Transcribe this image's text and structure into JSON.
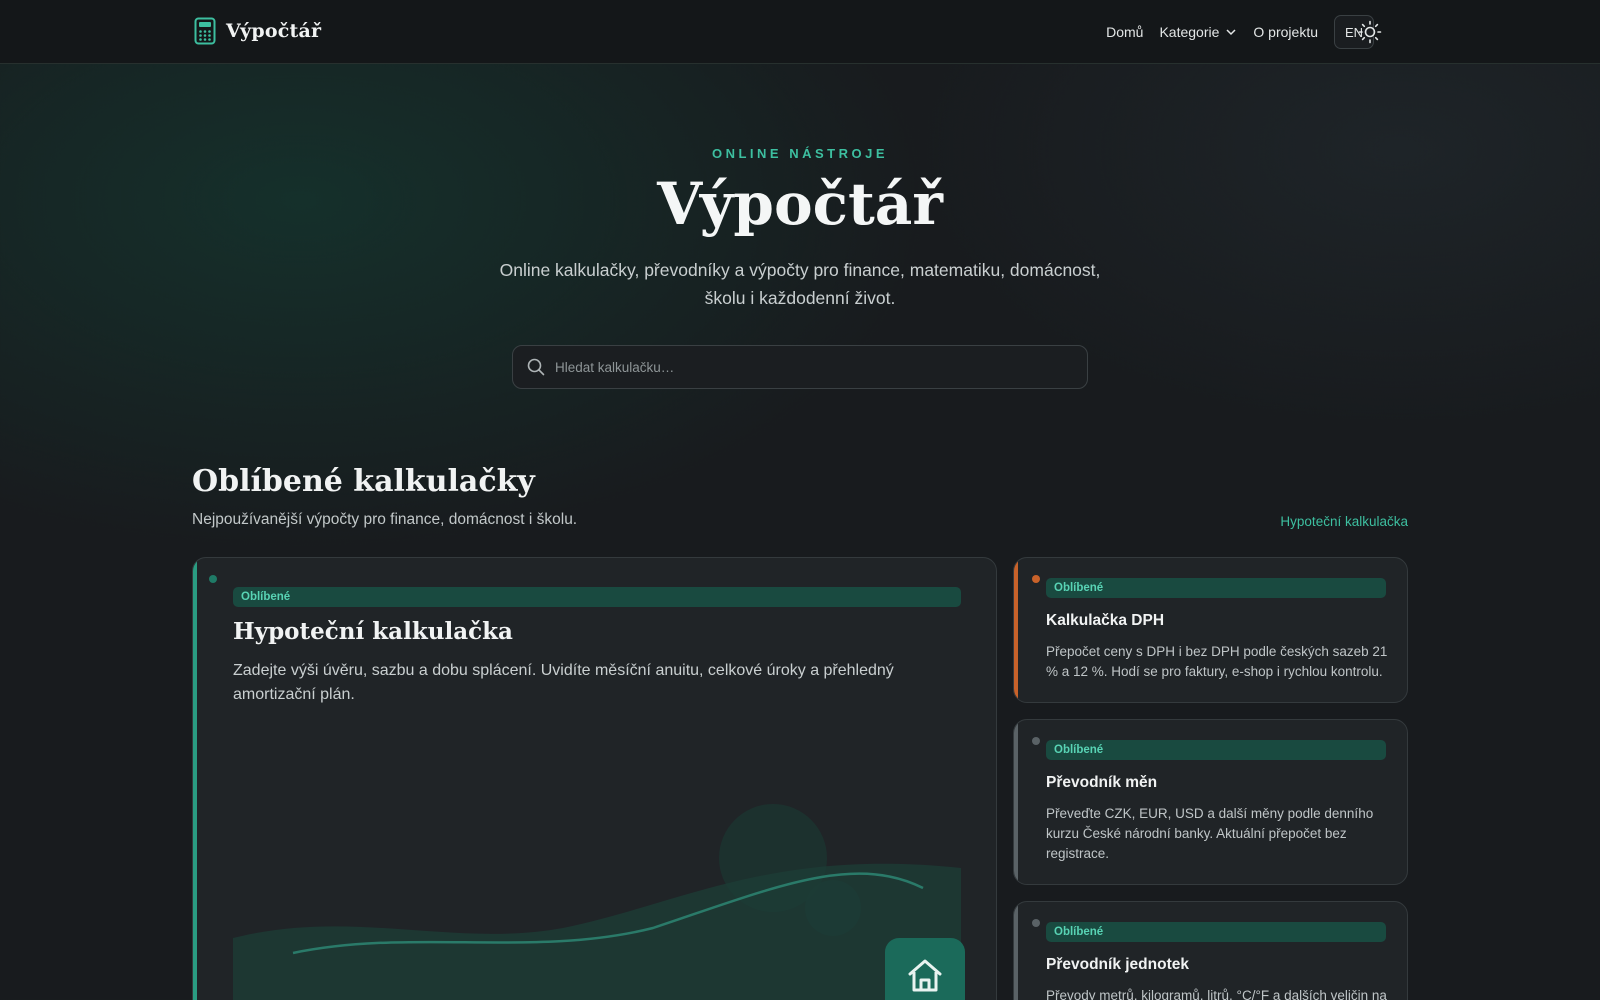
{
  "header": {
    "brand": "Výpočtář",
    "nav": {
      "home": "Domů",
      "categories": "Kategorie",
      "about": "O projektu",
      "lang": "EN"
    }
  },
  "hero": {
    "eyebrow": "ONLINE NÁSTROJE",
    "title": "Výpočtář",
    "subtitle": "Online kalkulačky, převodníky a výpočty pro finance, matematiku, domácnost, školu i každodenní život.",
    "search_placeholder": "Hledat kalkulačku…"
  },
  "favorites": {
    "title": "Oblíbené kalkulačky",
    "subtitle": "Nejpoužívanější výpočty pro finance, domácnost i školu.",
    "link": "Hypoteční kalkulačka",
    "featured": {
      "badge": "Oblíbené",
      "title": "Hypoteční kalkulačka",
      "description": "Zadejte výši úvěru, sazbu a dobu splácení. Uvidíte měsíční anuitu, celkové úroky a přehledný amortizační plán."
    },
    "cards": [
      {
        "badge": "Oblíbené",
        "title": "Kalkulačka DPH",
        "description": "Přepočet ceny s DPH i bez DPH podle českých sazeb 21 % a 12 %. Hodí se pro faktury, e-shop i rychlou kontrolu."
      },
      {
        "badge": "Oblíbené",
        "title": "Převodník měn",
        "description": "Převeďte CZK, EUR, USD a další měny podle denního kurzu České národní banky. Aktuální přepočet bez registrace."
      },
      {
        "badge": "Oblíbené",
        "title": "Převodník jednotek",
        "description": "Převody metrů, kilogramů, litrů, °C/°F a dalších veličin na"
      }
    ]
  },
  "colors": {
    "accent": "#3dbfa0",
    "orange_accent": "#c8622a",
    "grey_accent": "#5a6266"
  }
}
